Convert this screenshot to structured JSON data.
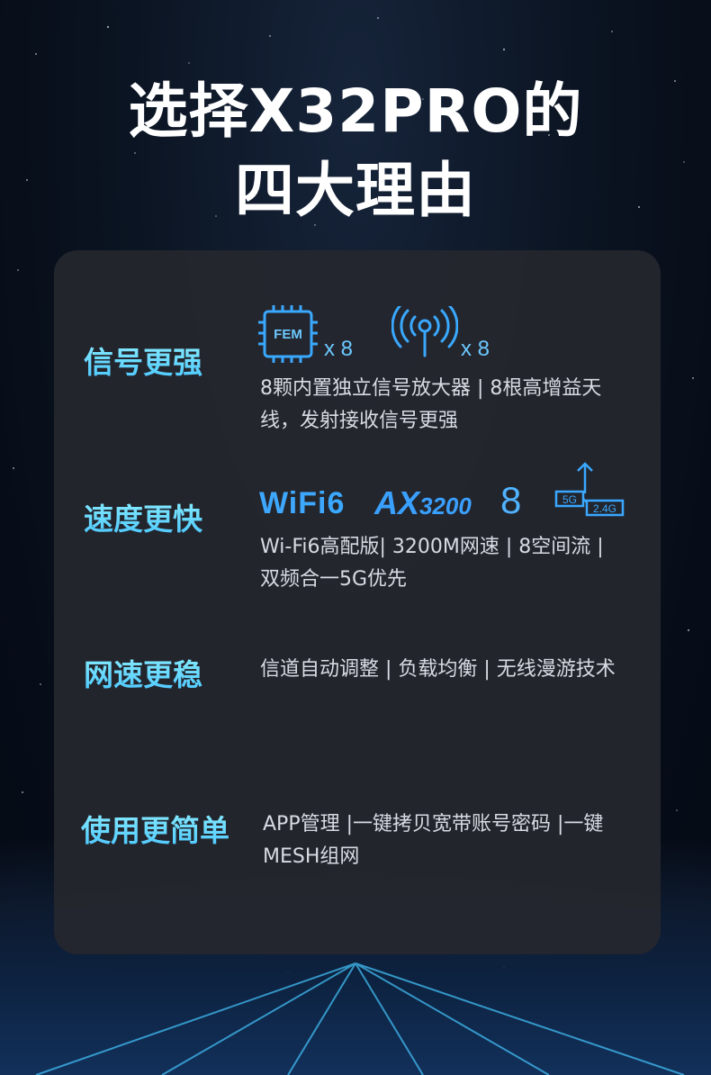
{
  "title": {
    "line1": "选择X32PRO的",
    "line2": "四大理由"
  },
  "rows": [
    {
      "title": "信号更强",
      "icons": [
        {
          "name": "fem-chip-icon",
          "label": "FEM",
          "multiplier": "x 8"
        },
        {
          "name": "antenna-signal-icon",
          "multiplier": "x 8"
        }
      ],
      "desc_line1": "8颗内置独立信号放大器 | 8根高增益天",
      "desc_line2": "线，发射接收信号更强"
    },
    {
      "title": "速度更快",
      "icons": [
        {
          "name": "wifi6-logo",
          "label": "WiFi",
          "badge": "6"
        },
        {
          "name": "ax3200-logo",
          "label_a": "AX",
          "label_b": "3200"
        },
        {
          "name": "eight-streams-icon",
          "label": "8"
        },
        {
          "name": "dual-band-icon",
          "label_a": "5G",
          "label_b": "2.4G"
        }
      ],
      "desc_line1": "Wi-Fi6高配版| 3200M网速 | 8空间流 |",
      "desc_line2": "双频合一5G优先"
    },
    {
      "title": "网速更稳",
      "desc_line1": "信道自动调整 | 负载均衡 | 无线漫游技术"
    },
    {
      "title": "使用更简单",
      "desc_line1": "APP管理 |一键拷贝宽带账号密码 |一键",
      "desc_line2": "MESH组网"
    }
  ],
  "colors": {
    "accent": "#49c6ff",
    "card_bg": "#24272e",
    "text": "#d7dbe2"
  }
}
